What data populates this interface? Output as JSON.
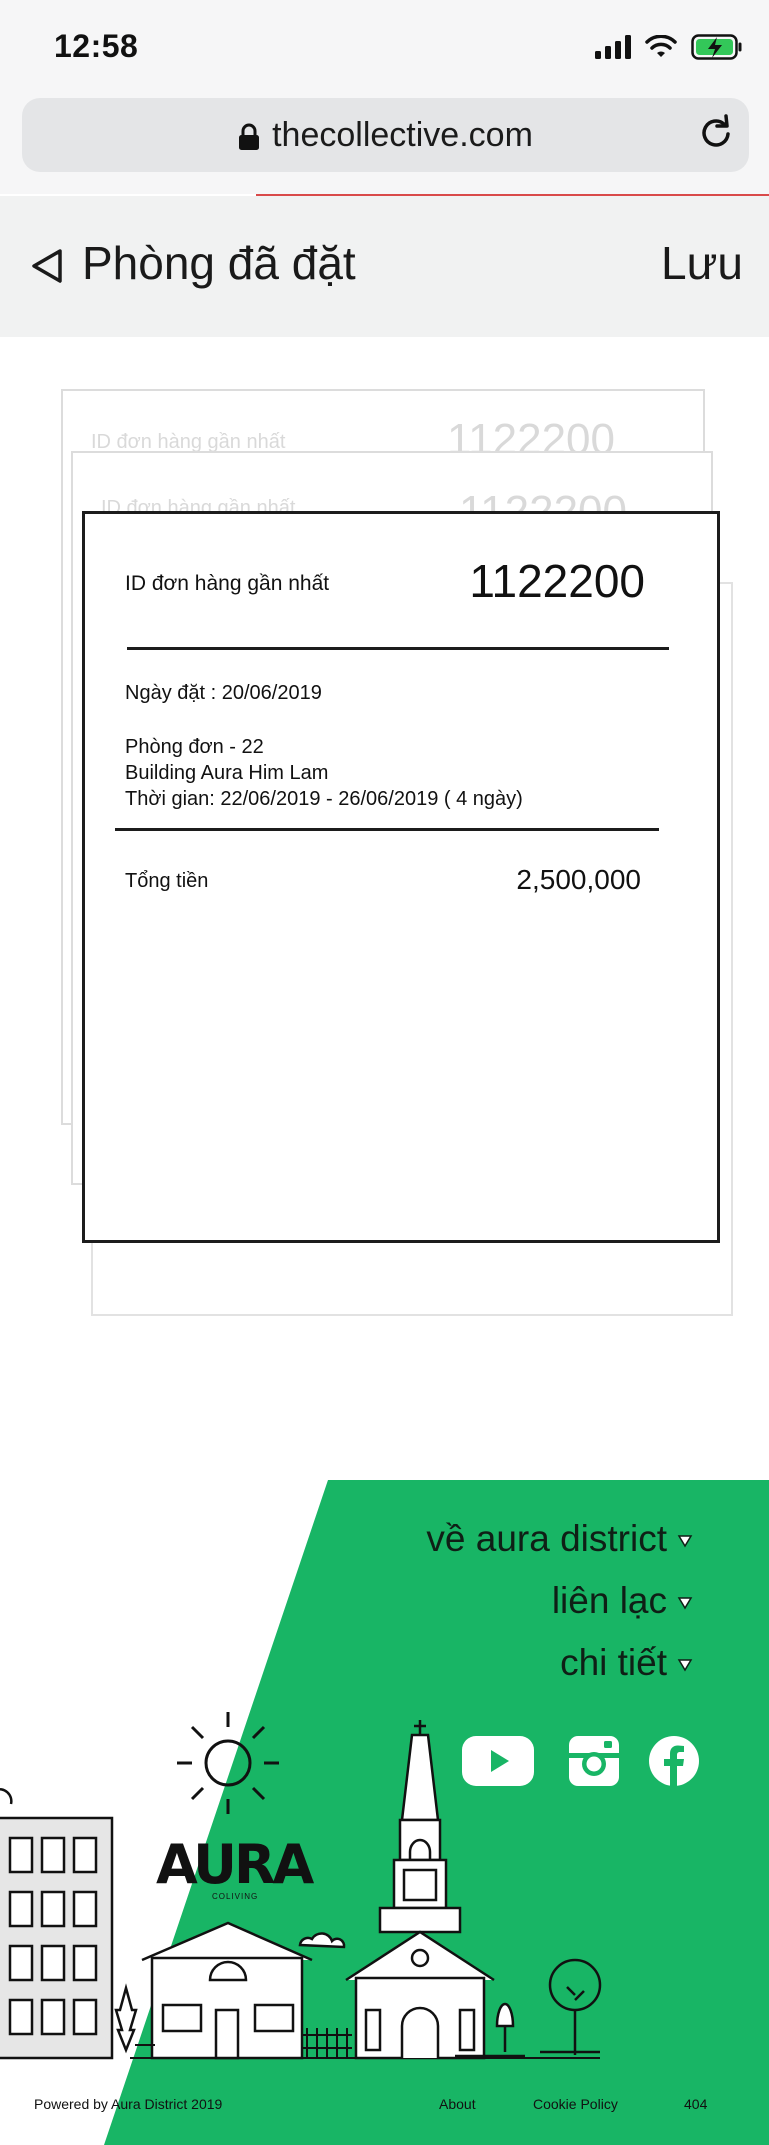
{
  "status_bar": {
    "time": "12:58"
  },
  "browser": {
    "url": "thecollective.com"
  },
  "nav": {
    "title": "Phòng đã đặt",
    "save_label": "Lưu"
  },
  "receipt": {
    "id_label": "ID đơn hàng gần nhất",
    "id_value": "1122200",
    "date_line": "Ngày đặt : 20/06/2019",
    "room": "Phòng đơn - 22",
    "building": "Building Aura Him Lam",
    "stay": "Thời gian: 22/06/2019 - 26/06/2019 ( 4 ngày)",
    "total_label": "Tổng tiền",
    "total_value": "2,500,000"
  },
  "footer": {
    "links": [
      {
        "label": "về aura district"
      },
      {
        "label": "liên lạc"
      },
      {
        "label": "chi tiết"
      }
    ],
    "social": [
      "youtube-icon",
      "instagram-icon",
      "facebook-icon"
    ],
    "logo_text": "AURA",
    "logo_sub": "COLIVING",
    "powered_by": "Powered by Aura District 2019",
    "about": "About",
    "cookie": "Cookie Policy",
    "error_code": "404"
  },
  "colors": {
    "brand_green": "#18b565",
    "page_bg": "#ffffff",
    "nav_bg": "#f1f2f2"
  }
}
